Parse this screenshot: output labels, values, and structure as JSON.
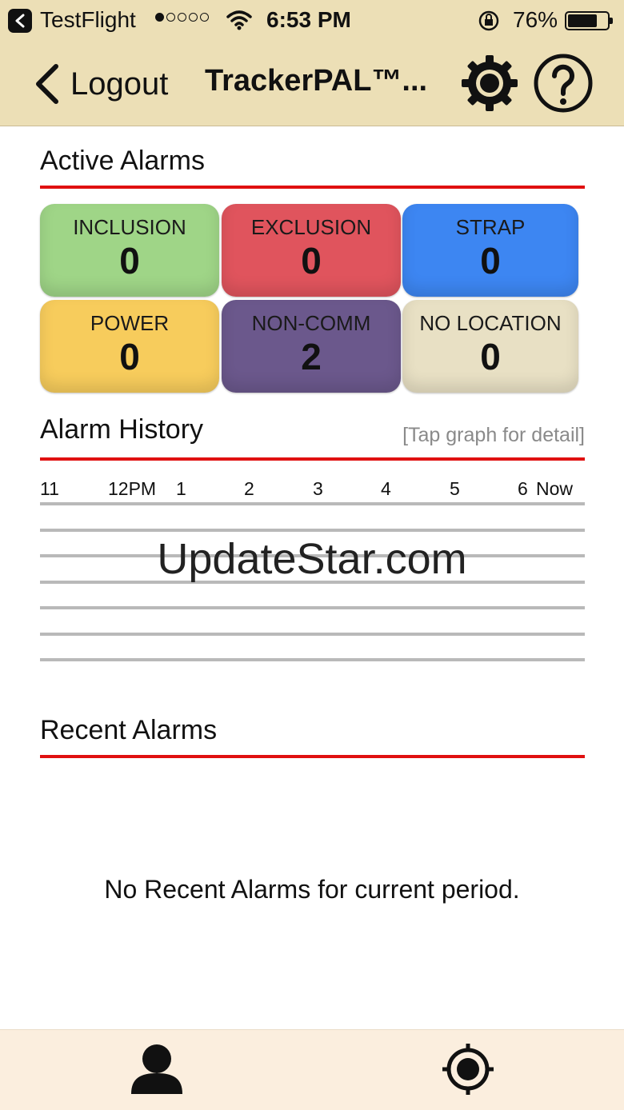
{
  "status_bar": {
    "carrier": "TestFlight",
    "time": "6:53 PM",
    "battery_percent": "76%",
    "battery_level": 0.76,
    "signal_bars": 1
  },
  "nav": {
    "back_label": "Logout",
    "title": "TrackerPAL™..."
  },
  "active_alarms": {
    "heading": "Active Alarms",
    "tiles": [
      {
        "label": "INCLUSION",
        "count": "0",
        "color": "#9fd587"
      },
      {
        "label": "EXCLUSION",
        "count": "0",
        "color": "#e0545d"
      },
      {
        "label": "STRAP",
        "count": "0",
        "color": "#3d86f2"
      },
      {
        "label": "POWER",
        "count": "0",
        "color": "#f7cc5c"
      },
      {
        "label": "NON-COMM",
        "count": "2",
        "color": "#6b588c"
      },
      {
        "label": "NO LOCATION",
        "count": "0",
        "color": "#e8e0c4"
      }
    ]
  },
  "alarm_history": {
    "heading": "Alarm History",
    "hint": "[Tap graph for detail]",
    "hours": [
      "11",
      "12PM",
      "1",
      "2",
      "3",
      "4",
      "5",
      "6",
      "Now"
    ]
  },
  "watermark": "UpdateStar.com",
  "recent_alarms": {
    "heading": "Recent Alarms",
    "empty_message": "No Recent Alarms for current period."
  },
  "colors": {
    "nav_bg": "#ecdfb6",
    "section_rule": "#e01010",
    "tabbar_bg": "#fbeede"
  },
  "icons": {
    "tab_left": "person-icon",
    "tab_right": "target-icon"
  }
}
